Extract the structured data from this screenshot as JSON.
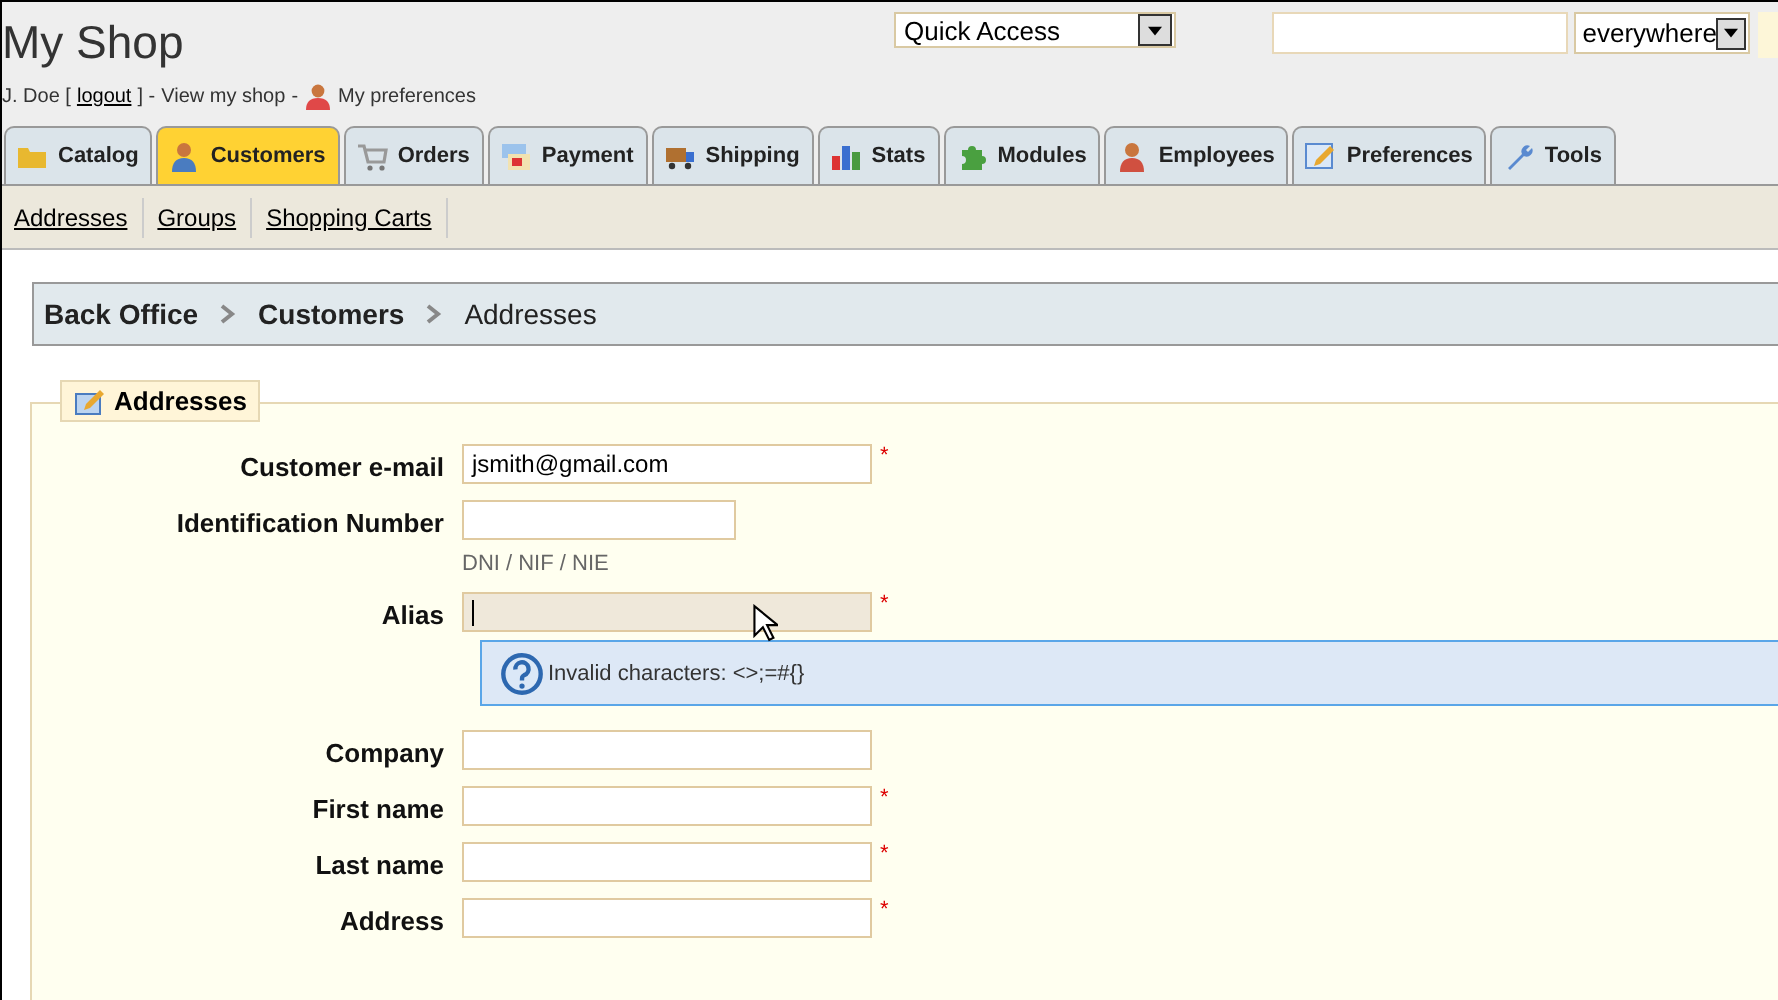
{
  "header": {
    "title": "My Shop",
    "user": "J. Doe [",
    "logout": "logout",
    "after_logout": "] -",
    "view_shop": "View my shop",
    "sep": "-",
    "preferences": "My preferences"
  },
  "quick_access": {
    "value": "Quick Access"
  },
  "search": {
    "scope": "everywhere"
  },
  "tabs": [
    {
      "label": "Catalog",
      "kind": "folder",
      "selected": false
    },
    {
      "label": "Customers",
      "kind": "person",
      "selected": true
    },
    {
      "label": "Orders",
      "kind": "cart",
      "selected": false
    },
    {
      "label": "Payment",
      "kind": "card",
      "selected": false
    },
    {
      "label": "Shipping",
      "kind": "truck",
      "selected": false
    },
    {
      "label": "Stats",
      "kind": "chart",
      "selected": false
    },
    {
      "label": "Modules",
      "kind": "puzzle",
      "selected": false
    },
    {
      "label": "Employees",
      "kind": "employee",
      "selected": false
    },
    {
      "label": "Preferences",
      "kind": "pencil",
      "selected": false
    },
    {
      "label": "Tools",
      "kind": "wrench",
      "selected": false
    }
  ],
  "subtabs": [
    "Addresses",
    "Groups",
    "Shopping Carts"
  ],
  "breadcrumb": [
    "Back Office",
    "Customers",
    "Addresses"
  ],
  "form": {
    "legend": "Addresses",
    "fields": [
      {
        "label": "Customer e-mail",
        "value": "jsmith@gmail.com",
        "kind": "long",
        "required_mark": "*",
        "focused": false
      },
      {
        "label": "Identification Number",
        "kind": "short",
        "focused": false,
        "hint": "DNI / NIF / NIE"
      },
      {
        "label": "Alias",
        "kind": "long",
        "required_mark": "*",
        "focused": true,
        "tooltip": "Invalid characters: <>;=#{}"
      },
      {
        "label": "Company",
        "kind": "long",
        "focused": false
      },
      {
        "label": "First name",
        "kind": "long",
        "required_mark": "*",
        "focused": false
      },
      {
        "label": "Last name",
        "kind": "long",
        "required_mark": "*",
        "focused": false
      },
      {
        "label": "Address",
        "kind": "long",
        "required_mark": "*",
        "focused": false
      }
    ]
  }
}
